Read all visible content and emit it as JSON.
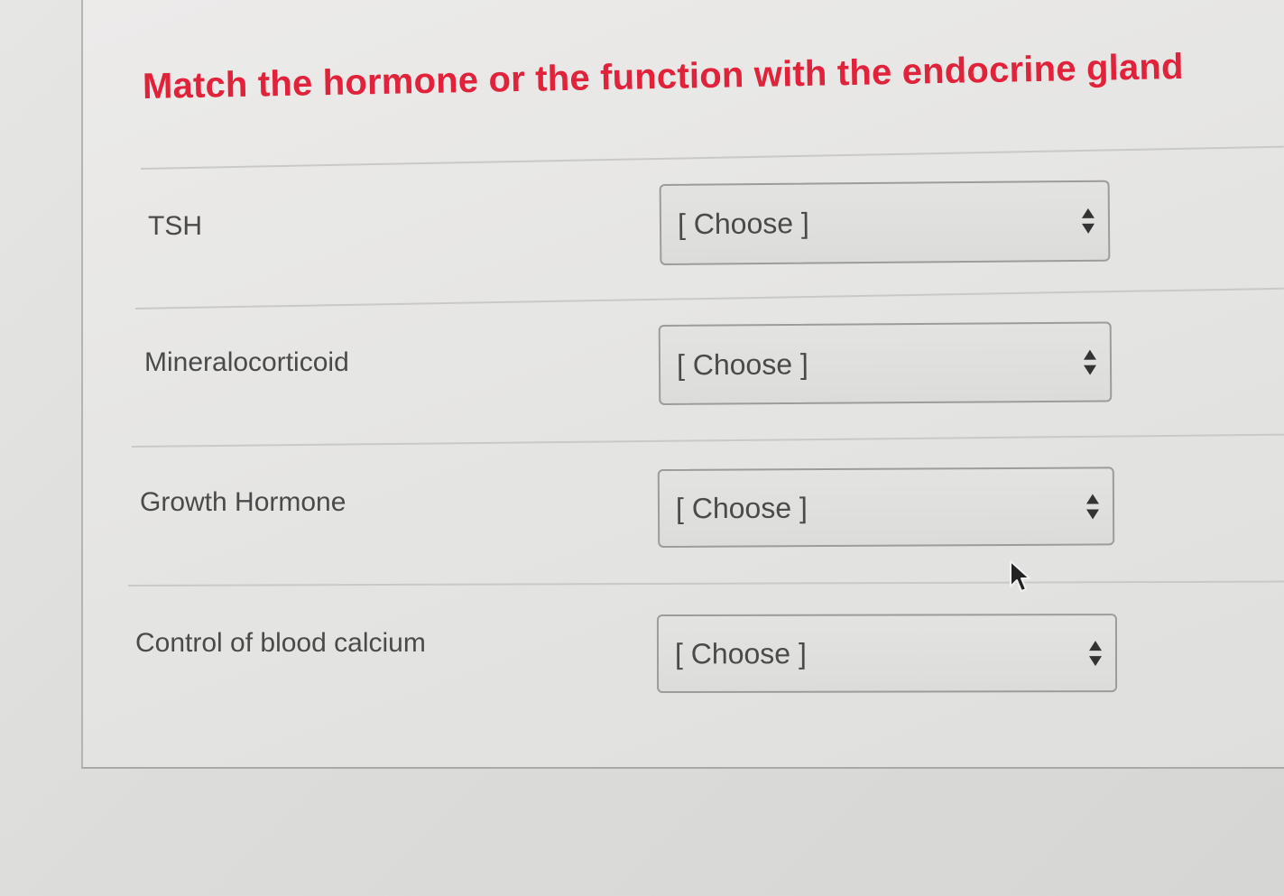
{
  "question": {
    "title": "Match the hormone or the function with the endocrine gland",
    "title_color": "#e0233a"
  },
  "rows": [
    {
      "label": "TSH",
      "selected": "[ Choose ]"
    },
    {
      "label": "Mineralocorticoid",
      "selected": "[ Choose ]"
    },
    {
      "label": "Growth Hormone",
      "selected": "[ Choose ]"
    },
    {
      "label": "Control of blood calcium",
      "selected": "[ Choose ]"
    }
  ],
  "icons": {
    "dropdown": "up-down-arrows-icon",
    "pointer": "mouse-pointer-icon"
  }
}
